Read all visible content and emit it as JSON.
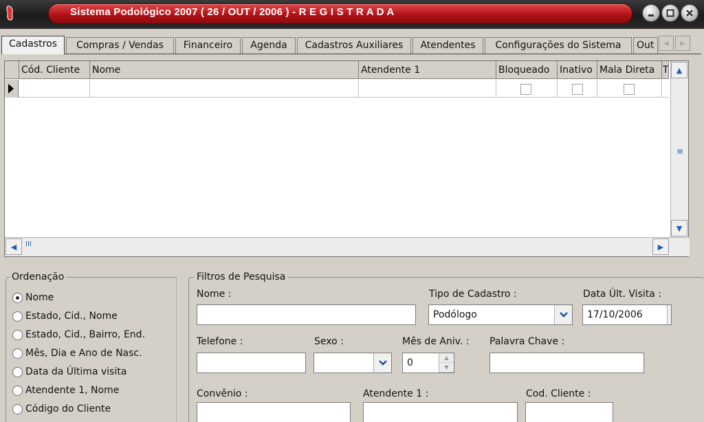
{
  "window": {
    "title": "Sistema Podológico 2007 ( 26 / OUT / 2006 ) - R E G I S T R A D A"
  },
  "tabs": [
    {
      "label": "Cadastros",
      "active": true
    },
    {
      "label": "Compras / Vendas"
    },
    {
      "label": "Financeiro"
    },
    {
      "label": "Agenda"
    },
    {
      "label": "Cadastros Auxiliares"
    },
    {
      "label": "Atendentes"
    },
    {
      "label": "Configurações do Sistema"
    },
    {
      "label": "Out"
    }
  ],
  "grid": {
    "columns": [
      "Cód. Cliente",
      "Nome",
      "Atendente 1",
      "Bloqueado",
      "Inativo",
      "Mala Direta",
      "T"
    ]
  },
  "ordenacao": {
    "label": "Ordenação",
    "options": [
      {
        "label": "Nome",
        "selected": true
      },
      {
        "label": "Estado, Cid., Nome"
      },
      {
        "label": "Estado, Cid., Bairro, End."
      },
      {
        "label": "Mês, Dia e Ano de Nasc."
      },
      {
        "label": "Data da Última visita"
      },
      {
        "label": "Atendente 1, Nome"
      },
      {
        "label": "Código do Cliente"
      }
    ]
  },
  "filtros": {
    "label": "Filtros de Pesquisa",
    "nome_label": "Nome :",
    "nome_value": "",
    "tipo_label": "Tipo de Cadastro :",
    "tipo_value": "Podólogo",
    "data_label": "Data Últ. Visita :",
    "data_value": "17/10/2006",
    "telefone_label": "Telefone :",
    "sexo_label": "Sexo :",
    "sexo_value": "",
    "mes_label": "Mês de Aniv. :",
    "mes_value": "0",
    "palavra_label": "Palavra Chave :",
    "convenio_label": "Convênio :",
    "atendente_label": "Atendente 1 :",
    "cod_label": "Cod. Cliente :"
  },
  "colors": {
    "title_red": "#b11217",
    "scroll_blue": "#1e5fb8"
  }
}
